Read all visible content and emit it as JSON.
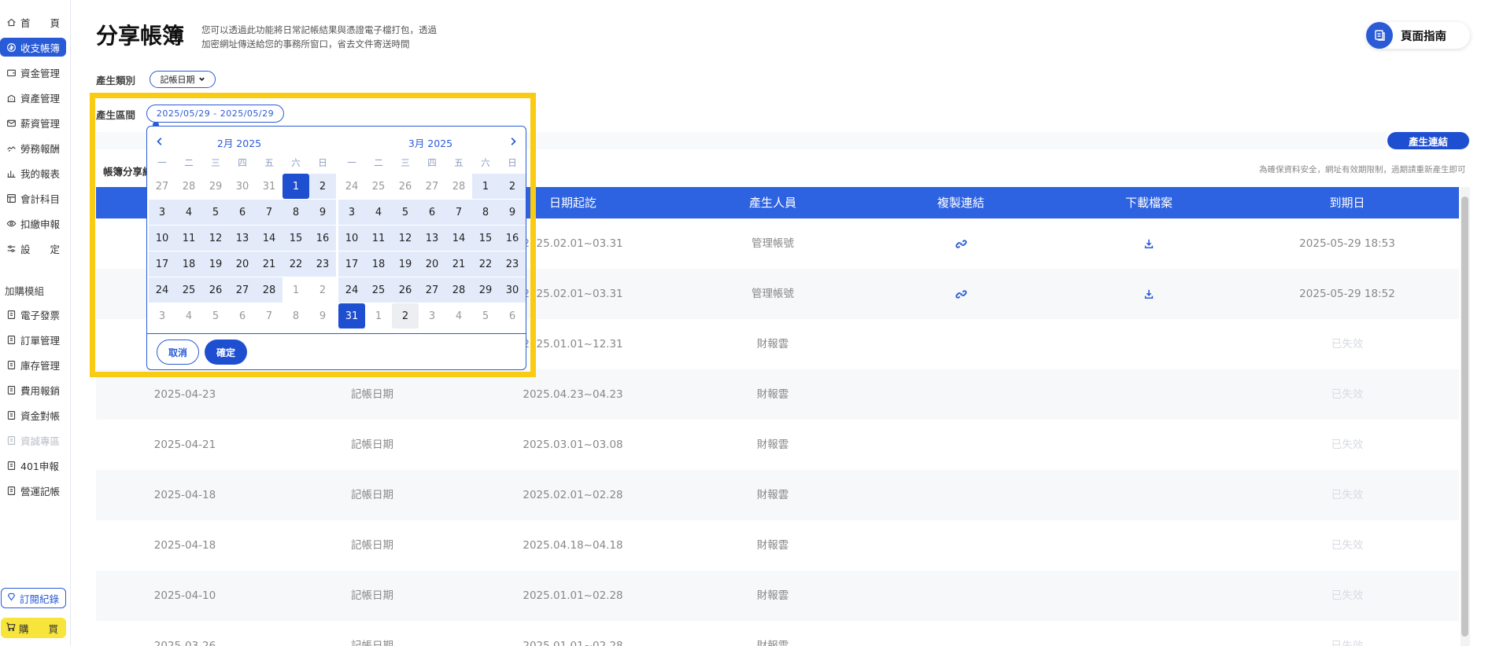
{
  "sidebar": {
    "items": [
      {
        "label": "首　　頁",
        "icon": "home-icon"
      },
      {
        "label": "收支帳簿",
        "icon": "coin-icon"
      },
      {
        "label": "資金管理",
        "icon": "wallet-icon"
      },
      {
        "label": "資產管理",
        "icon": "building-icon"
      },
      {
        "label": "薪資管理",
        "icon": "envelope-icon"
      },
      {
        "label": "勞務報酬",
        "icon": "handshake-icon"
      },
      {
        "label": "我的報表",
        "icon": "bar-chart-icon"
      },
      {
        "label": "會計科目",
        "icon": "grid-icon"
      },
      {
        "label": "扣繳申報",
        "icon": "eye-icon"
      },
      {
        "label": "設　　定",
        "icon": "sliders-icon"
      }
    ],
    "addon_label": "加購模組",
    "addon_items": [
      {
        "label": "電子發票"
      },
      {
        "label": "訂單管理"
      },
      {
        "label": "庫存管理"
      },
      {
        "label": "費用報銷"
      },
      {
        "label": "資金對帳"
      },
      {
        "label": "資誠專區"
      },
      {
        "label": "401申報"
      },
      {
        "label": "營運記帳"
      }
    ],
    "subscribe_label": "訂閱紀錄",
    "buy_label": "購　　買"
  },
  "header": {
    "title": "分享帳簿",
    "desc_line1": "您可以透過此功能將日常記帳結果與憑證電子檔打包，透過",
    "desc_line2": "加密網址傳送給您的事務所窗口，省去文件寄送時間",
    "guide_label": "頁面指南"
  },
  "filters": {
    "type_label": "產生類別",
    "type_value": "記帳日期",
    "range_label": "產生區間",
    "range_value": "2025/05/29 - 2025/05/29",
    "generate_label": "產生連結"
  },
  "section": {
    "label": "帳簿分享紀",
    "notice": "為確保資料安全，網址有效期限制，過期請重新產生即可"
  },
  "table": {
    "columns": [
      "日期起訖",
      "產生人員",
      "複製連結",
      "下載檔案",
      "到期日"
    ],
    "rows": [
      {
        "created": "",
        "type": "",
        "period": "2025.02.01~03.31",
        "user": "管理帳號",
        "has_links": true,
        "expiry": "2025-05-29 18:53",
        "expired": false
      },
      {
        "created": "",
        "type": "",
        "period": "2025.02.01~03.31",
        "user": "管理帳號",
        "has_links": true,
        "expiry": "2025-05-29 18:52",
        "expired": false
      },
      {
        "created": "",
        "type": "",
        "period": "2025.01.01~12.31",
        "user": "財報雲",
        "has_links": false,
        "expiry": "已失效",
        "expired": true
      },
      {
        "created": "2025-04-23",
        "type": "記帳日期",
        "period": "2025.04.23~04.23",
        "user": "財報雲",
        "has_links": false,
        "expiry": "已失效",
        "expired": true
      },
      {
        "created": "2025-04-21",
        "type": "記帳日期",
        "period": "2025.03.01~03.08",
        "user": "財報雲",
        "has_links": false,
        "expiry": "已失效",
        "expired": true
      },
      {
        "created": "2025-04-18",
        "type": "記帳日期",
        "period": "2025.02.01~02.28",
        "user": "財報雲",
        "has_links": false,
        "expiry": "已失效",
        "expired": true
      },
      {
        "created": "2025-04-18",
        "type": "記帳日期",
        "period": "2025.04.18~04.18",
        "user": "財報雲",
        "has_links": false,
        "expiry": "已失效",
        "expired": true
      },
      {
        "created": "2025-04-10",
        "type": "記帳日期",
        "period": "2025.01.01~02.28",
        "user": "財報雲",
        "has_links": false,
        "expiry": "已失效",
        "expired": true
      },
      {
        "created": "2025-03-26",
        "type": "記帳日期",
        "period": "2025.01.01~02.28",
        "user": "財報雲",
        "has_links": false,
        "expiry": "已失效",
        "expired": true
      }
    ]
  },
  "datepicker": {
    "weekdays": [
      "一",
      "二",
      "三",
      "四",
      "五",
      "六",
      "日"
    ],
    "months": [
      {
        "title": "2月 2025",
        "weeks": [
          [
            {
              "d": "27",
              "s": "muted"
            },
            {
              "d": "28",
              "s": "muted"
            },
            {
              "d": "29",
              "s": "muted"
            },
            {
              "d": "30",
              "s": "muted"
            },
            {
              "d": "31",
              "s": "muted"
            },
            {
              "d": "1",
              "s": "selected"
            },
            {
              "d": "2",
              "s": "inrange"
            }
          ],
          [
            {
              "d": "3",
              "s": "inrange"
            },
            {
              "d": "4",
              "s": "inrange"
            },
            {
              "d": "5",
              "s": "inrange"
            },
            {
              "d": "6",
              "s": "inrange"
            },
            {
              "d": "7",
              "s": "inrange"
            },
            {
              "d": "8",
              "s": "inrange"
            },
            {
              "d": "9",
              "s": "inrange"
            }
          ],
          [
            {
              "d": "10",
              "s": "inrange"
            },
            {
              "d": "11",
              "s": "inrange"
            },
            {
              "d": "12",
              "s": "inrange"
            },
            {
              "d": "13",
              "s": "inrange"
            },
            {
              "d": "14",
              "s": "inrange"
            },
            {
              "d": "15",
              "s": "inrange"
            },
            {
              "d": "16",
              "s": "inrange"
            }
          ],
          [
            {
              "d": "17",
              "s": "inrange"
            },
            {
              "d": "18",
              "s": "inrange"
            },
            {
              "d": "19",
              "s": "inrange"
            },
            {
              "d": "20",
              "s": "inrange"
            },
            {
              "d": "21",
              "s": "inrange"
            },
            {
              "d": "22",
              "s": "inrange"
            },
            {
              "d": "23",
              "s": "inrange"
            }
          ],
          [
            {
              "d": "24",
              "s": "inrange"
            },
            {
              "d": "25",
              "s": "inrange"
            },
            {
              "d": "26",
              "s": "inrange"
            },
            {
              "d": "27",
              "s": "inrange"
            },
            {
              "d": "28",
              "s": "inrange"
            },
            {
              "d": "1",
              "s": "muted"
            },
            {
              "d": "2",
              "s": "muted"
            }
          ],
          [
            {
              "d": "3",
              "s": "muted"
            },
            {
              "d": "4",
              "s": "muted"
            },
            {
              "d": "5",
              "s": "muted"
            },
            {
              "d": "6",
              "s": "muted"
            },
            {
              "d": "7",
              "s": "muted"
            },
            {
              "d": "8",
              "s": "muted"
            },
            {
              "d": "9",
              "s": "muted"
            }
          ]
        ]
      },
      {
        "title": "3月 2025",
        "weeks": [
          [
            {
              "d": "24",
              "s": "muted"
            },
            {
              "d": "25",
              "s": "muted"
            },
            {
              "d": "26",
              "s": "muted"
            },
            {
              "d": "27",
              "s": "muted"
            },
            {
              "d": "28",
              "s": "muted"
            },
            {
              "d": "1",
              "s": "inrange"
            },
            {
              "d": "2",
              "s": "inrange"
            }
          ],
          [
            {
              "d": "3",
              "s": "inrange"
            },
            {
              "d": "4",
              "s": "inrange"
            },
            {
              "d": "5",
              "s": "inrange"
            },
            {
              "d": "6",
              "s": "inrange"
            },
            {
              "d": "7",
              "s": "inrange"
            },
            {
              "d": "8",
              "s": "inrange"
            },
            {
              "d": "9",
              "s": "inrange"
            }
          ],
          [
            {
              "d": "10",
              "s": "inrange"
            },
            {
              "d": "11",
              "s": "inrange"
            },
            {
              "d": "12",
              "s": "inrange"
            },
            {
              "d": "13",
              "s": "inrange"
            },
            {
              "d": "14",
              "s": "inrange"
            },
            {
              "d": "15",
              "s": "inrange"
            },
            {
              "d": "16",
              "s": "inrange"
            }
          ],
          [
            {
              "d": "17",
              "s": "inrange"
            },
            {
              "d": "18",
              "s": "inrange"
            },
            {
              "d": "19",
              "s": "inrange"
            },
            {
              "d": "20",
              "s": "inrange"
            },
            {
              "d": "21",
              "s": "inrange"
            },
            {
              "d": "22",
              "s": "inrange"
            },
            {
              "d": "23",
              "s": "inrange"
            }
          ],
          [
            {
              "d": "24",
              "s": "inrange"
            },
            {
              "d": "25",
              "s": "inrange"
            },
            {
              "d": "26",
              "s": "inrange"
            },
            {
              "d": "27",
              "s": "inrange"
            },
            {
              "d": "28",
              "s": "inrange"
            },
            {
              "d": "29",
              "s": "inrange"
            },
            {
              "d": "30",
              "s": "inrange"
            }
          ],
          [
            {
              "d": "31",
              "s": "selected"
            },
            {
              "d": "1",
              "s": "muted"
            },
            {
              "d": "2",
              "s": "hover"
            },
            {
              "d": "3",
              "s": "muted"
            },
            {
              "d": "4",
              "s": "muted"
            },
            {
              "d": "5",
              "s": "muted"
            },
            {
              "d": "6",
              "s": "muted"
            }
          ]
        ]
      }
    ],
    "cancel_label": "取消",
    "ok_label": "確定"
  },
  "colors": {
    "primary": "#2a5bd7",
    "table_header": "#2d62e0",
    "highlight": "#f9cc13",
    "buy": "#f7e53b"
  }
}
